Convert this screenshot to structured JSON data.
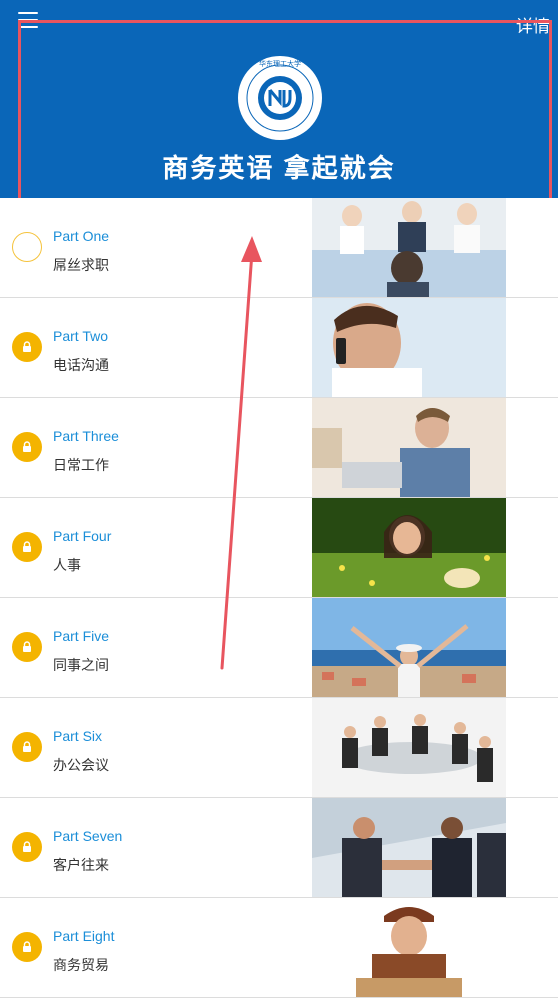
{
  "header": {
    "detail_label": "详情",
    "slogan": "商务英语 拿起就会",
    "logo_ring_text": "ECUST CHINA UNIVERSITY OF SCIENCE AND TECHNOLOGY",
    "logo_top_text": "华东理工大学"
  },
  "lessons": [
    {
      "title": "Part One",
      "subtitle": "屌丝求职",
      "state": "current",
      "thumb": "interview-photo"
    },
    {
      "title": "Part Two",
      "subtitle": "电话沟通",
      "state": "locked",
      "thumb": "phone-call-photo"
    },
    {
      "title": "Part Three",
      "subtitle": "日常工作",
      "state": "locked",
      "thumb": "office-work-photo"
    },
    {
      "title": "Part Four",
      "subtitle": "人事",
      "state": "locked",
      "thumb": "child-grass-photo"
    },
    {
      "title": "Part Five",
      "subtitle": "同事之间",
      "state": "locked",
      "thumb": "coastal-city-photo"
    },
    {
      "title": "Part Six",
      "subtitle": "办公会议",
      "state": "locked",
      "thumb": "meeting-photo"
    },
    {
      "title": "Part Seven",
      "subtitle": "客户往来",
      "state": "locked",
      "thumb": "handshake-photo"
    },
    {
      "title": "Part Eight",
      "subtitle": "商务贸易",
      "state": "locked",
      "thumb": "delivery-photo"
    }
  ],
  "colors": {
    "brand_blue": "#0a66b8",
    "timeline_gold": "#f5c33c",
    "title_blue": "#1b8ed8",
    "annotation_red": "#e8555f"
  }
}
